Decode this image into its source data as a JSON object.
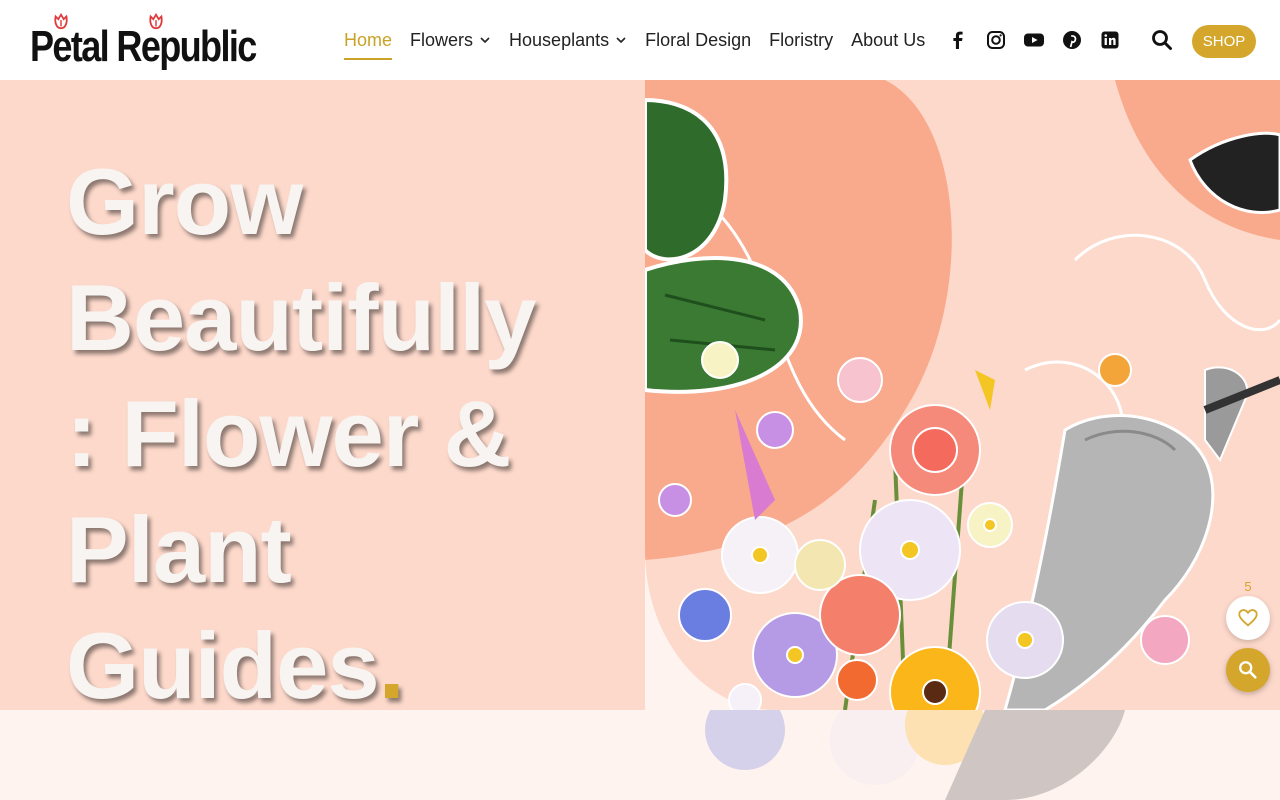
{
  "brand": {
    "name": "Petal Republic"
  },
  "nav": {
    "items": [
      {
        "label": "Home",
        "active": true,
        "dropdown": false
      },
      {
        "label": "Flowers",
        "active": false,
        "dropdown": true
      },
      {
        "label": "Houseplants",
        "active": false,
        "dropdown": true
      },
      {
        "label": "Floral Design",
        "active": false,
        "dropdown": false
      },
      {
        "label": "Floristry",
        "active": false,
        "dropdown": false
      },
      {
        "label": "About Us",
        "active": false,
        "dropdown": false
      }
    ]
  },
  "social": [
    "facebook-icon",
    "instagram-icon",
    "youtube-icon",
    "pinterest-icon",
    "linkedin-icon"
  ],
  "header": {
    "shop_label": "SHOP"
  },
  "hero": {
    "headline_lines": [
      "Grow",
      "Beautifully",
      ": Flower &",
      "Plant",
      "Guides"
    ],
    "headline_end": "."
  },
  "favorites": {
    "count": "5"
  },
  "colors": {
    "accent": "#d4a62b",
    "hero_bg": "#fdd9cb",
    "blob": "#f9a98c"
  }
}
